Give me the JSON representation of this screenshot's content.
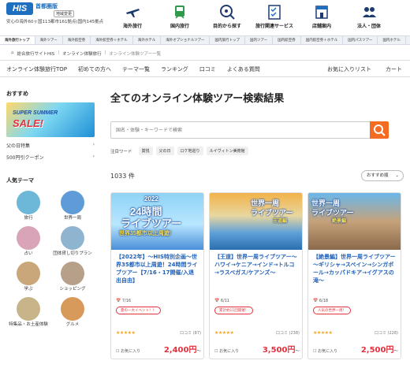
{
  "header": {
    "logo": "HIS",
    "region": "首都圏版",
    "region_select": "地域変更",
    "note": "安心の海外60ヶ国113都市161拠点(国内145拠点",
    "nav": [
      {
        "label": "海外旅行",
        "icon": "plane-icon"
      },
      {
        "label": "国内旅行",
        "icon": "train-icon"
      },
      {
        "label": "目的から探す",
        "icon": "search-globe-icon"
      },
      {
        "label": "旅行関連サービス",
        "icon": "checklist-icon"
      },
      {
        "label": "店舗案内",
        "icon": "store-icon"
      },
      {
        "label": "法人・団体",
        "icon": "people-icon"
      }
    ]
  },
  "tabs": [
    "海外旅行トップ",
    "海外ツアー",
    "海外航空券",
    "海外航空券＋ホテル",
    "海外ホテル",
    "海外オプショナルツアー",
    "国内旅行トップ",
    "国内ツアー",
    "国内航空券",
    "国内航空券＋ホテル",
    "国内パスツアー",
    "国内ホテル",
    "国内航空券＋ホテル"
  ],
  "breadcrumb": [
    "総合旅行サイトHIS",
    "オンライン体験旅行",
    "オンライン体験ツアー一覧"
  ],
  "subnav": {
    "left": [
      "オンライン体験旅行TOP",
      "初めての方へ",
      "テーマ一覧",
      "ランキング",
      "口コミ",
      "よくある質問"
    ],
    "right": [
      "お気に入りリスト",
      "カート"
    ]
  },
  "sidebar": {
    "recommend_heading": "おすすめ",
    "banner_top": "SUPER SUMMER",
    "banner_main": "SALE!",
    "links": [
      "父の日特集",
      "500円引クーポン"
    ],
    "theme_heading": "人気テーマ",
    "themes": [
      {
        "label": "旅行",
        "color": "#6db8d8"
      },
      {
        "label": "世界一周",
        "color": "#5f9bd6"
      },
      {
        "label": "占い",
        "color": "#d9a4b8"
      },
      {
        "label": "団体貸し切りプラン",
        "color": "#8fb4d0"
      },
      {
        "label": "学ぶ",
        "color": "#c9a77a"
      },
      {
        "label": "ショッピング",
        "color": "#b7a08a"
      },
      {
        "label": "特集品・お土産体験",
        "color": "#c8b489"
      },
      {
        "label": "グルメ",
        "color": "#d89a5a"
      }
    ]
  },
  "main": {
    "title": "全てのオンライン体験ツアー検索結果",
    "search_placeholder": "国名・体験・キーワードで検索",
    "keywords_heading": "注目ワード",
    "keywords": [
      "賞悦",
      "父の日",
      "ロケ地巡り",
      "ルイヴィトン美術館"
    ],
    "count": "1033 件",
    "sort": "おすすめ順"
  },
  "cards": [
    {
      "img_lines": [
        "2022",
        "24時間",
        "ライブツアー",
        "世界35都市以上周遊!"
      ],
      "title": "【2022年】～HIS特別企画～世界35都市以上周遊！24時間ライブツアー【7/16・17開催/入退出自由】",
      "date": "7/16",
      "badge": "夏の一大イベント！！",
      "rating_stars": "★★★★★",
      "reviews": "口コミ (87)",
      "fav": "お気に入り",
      "price": "2,400円",
      "price_suffix": "～"
    },
    {
      "img_lines": [
        "世界一周",
        "ライブツアー",
        "王道編"
      ],
      "title": "【王道】世界一周ライブツアー～ハワイ→ケニア→インド→トルコ→ラスベガス/ケアンズ～",
      "date": "6/11",
      "badge": "累計約11回開催！",
      "rating_stars": "★★★★★",
      "reviews": "口コミ (238)",
      "fav": "お気に入り",
      "price": "3,500円",
      "price_suffix": "～"
    },
    {
      "img_lines": [
        "世界一周",
        "ライブツアー",
        "絶景編"
      ],
      "title": "【絶景編】世界一周ライブツアー～ギリシャ→スペイン→シンガポール→カッパドキア→イグアスの滝～",
      "date": "6/18",
      "badge": "人気の世界一周！",
      "rating_stars": "★★★★★",
      "reviews": "口コミ (228)",
      "fav": "お気に入り",
      "price": "2,500円",
      "price_suffix": "～"
    }
  ]
}
